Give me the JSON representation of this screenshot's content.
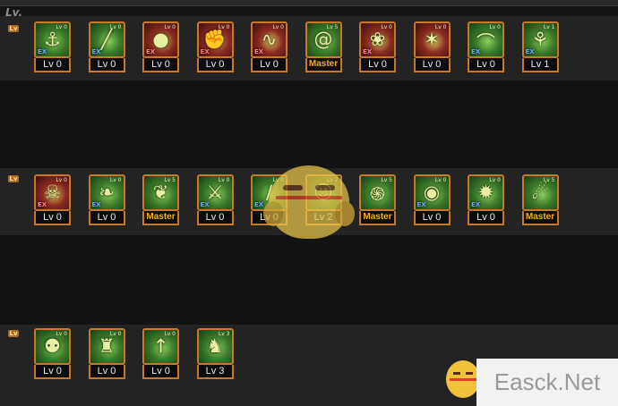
{
  "header": {
    "title": "Lv."
  },
  "rows": [
    {
      "tier_label": "Lv",
      "skills": [
        {
          "icon": "hook-skill-icon",
          "style": "green",
          "level": "Lv 0",
          "mini": "Lv 0",
          "badge": "EX"
        },
        {
          "icon": "pole-skill-icon",
          "style": "green",
          "level": "Lv 0",
          "mini": "Lv 0",
          "badge": "EX"
        },
        {
          "icon": "orb-skill-icon",
          "style": "red",
          "level": "Lv 0",
          "mini": "Lv 0",
          "badge": "EX"
        },
        {
          "icon": "fist-skill-icon",
          "style": "red",
          "level": "Lv 0",
          "mini": "Lv 0",
          "badge": "EX"
        },
        {
          "icon": "whip-skill-icon",
          "style": "red",
          "level": "Lv 0",
          "mini": "Lv 0",
          "badge": "EX"
        },
        {
          "icon": "coil-skill-icon",
          "style": "green",
          "level": "Master",
          "mini": "Lv 5",
          "badge": ""
        },
        {
          "icon": "bomb-skill-icon",
          "style": "red",
          "level": "Lv 0",
          "mini": "Lv 0",
          "badge": "EX"
        },
        {
          "icon": "strike-skill-icon",
          "style": "red",
          "level": "Lv 0",
          "mini": "Lv 0",
          "badge": ""
        },
        {
          "icon": "arc-skill-icon",
          "style": "green",
          "level": "Lv 0",
          "mini": "Lv 0",
          "badge": "EX"
        },
        {
          "icon": "spirit-skill-icon",
          "style": "green",
          "level": "Lv 1",
          "mini": "Lv 1",
          "badge": "EX"
        }
      ]
    },
    {
      "tier_label": "Lv",
      "skills": [
        {
          "icon": "bone-skill-icon",
          "style": "red",
          "level": "Lv 0",
          "mini": "Lv 0",
          "badge": "EX"
        },
        {
          "icon": "vine-skill-icon",
          "style": "green",
          "level": "Lv 0",
          "mini": "Lv 0",
          "badge": "EX"
        },
        {
          "icon": "beast-skill-icon",
          "style": "green",
          "level": "Master",
          "mini": "Lv 5",
          "badge": ""
        },
        {
          "icon": "blade-skill-icon",
          "style": "green",
          "level": "Lv 0",
          "mini": "Lv 0",
          "badge": "EX"
        },
        {
          "icon": "slash-skill-icon",
          "style": "green",
          "level": "Lv 0",
          "mini": "Lv 0",
          "badge": "EX"
        },
        {
          "icon": "mask-skill-icon",
          "style": "green",
          "level": "Lv 2",
          "mini": "Lv 2",
          "badge": ""
        },
        {
          "icon": "tornado-skill-icon",
          "style": "green",
          "level": "Master",
          "mini": "Lv 5",
          "badge": ""
        },
        {
          "icon": "seal-skill-icon",
          "style": "green",
          "level": "Lv 0",
          "mini": "Lv 0",
          "badge": "EX"
        },
        {
          "icon": "burst-skill-icon",
          "style": "green",
          "level": "Lv 0",
          "mini": "Lv 0",
          "badge": "EX"
        },
        {
          "icon": "vortex-skill-icon",
          "style": "green",
          "level": "Master",
          "mini": "Lv 5",
          "badge": ""
        }
      ]
    },
    {
      "tier_label": "Lv",
      "skills": [
        {
          "icon": "totem-skill-icon",
          "style": "green",
          "level": "Lv 0",
          "mini": "Lv 0",
          "badge": ""
        },
        {
          "icon": "giant-skill-icon",
          "style": "green",
          "level": "Lv 0",
          "mini": "Lv 0",
          "badge": ""
        },
        {
          "icon": "spear-skill-icon",
          "style": "green",
          "level": "Lv 0",
          "mini": "Lv 0",
          "badge": ""
        },
        {
          "icon": "golem-skill-icon",
          "style": "green",
          "level": "Lv 3",
          "mini": "Lv 3",
          "badge": ""
        }
      ]
    }
  ],
  "glyphs": {
    "hook-skill-icon": "⚓",
    "pole-skill-icon": "╱",
    "orb-skill-icon": "●",
    "fist-skill-icon": "✊",
    "whip-skill-icon": "∿",
    "coil-skill-icon": "@",
    "bomb-skill-icon": "❀",
    "strike-skill-icon": "✶",
    "arc-skill-icon": "⌒",
    "spirit-skill-icon": "⚘",
    "bone-skill-icon": "☠",
    "vine-skill-icon": "❧",
    "beast-skill-icon": "❦",
    "blade-skill-icon": "⚔",
    "slash-skill-icon": "∕",
    "mask-skill-icon": "☺",
    "tornado-skill-icon": "֍",
    "seal-skill-icon": "◉",
    "burst-skill-icon": "✹",
    "vortex-skill-icon": "☄",
    "totem-skill-icon": "⚉",
    "giant-skill-icon": "♜",
    "spear-skill-icon": "↑",
    "golem-skill-icon": "♞"
  },
  "watermark": {
    "text": "Easck.Net"
  }
}
